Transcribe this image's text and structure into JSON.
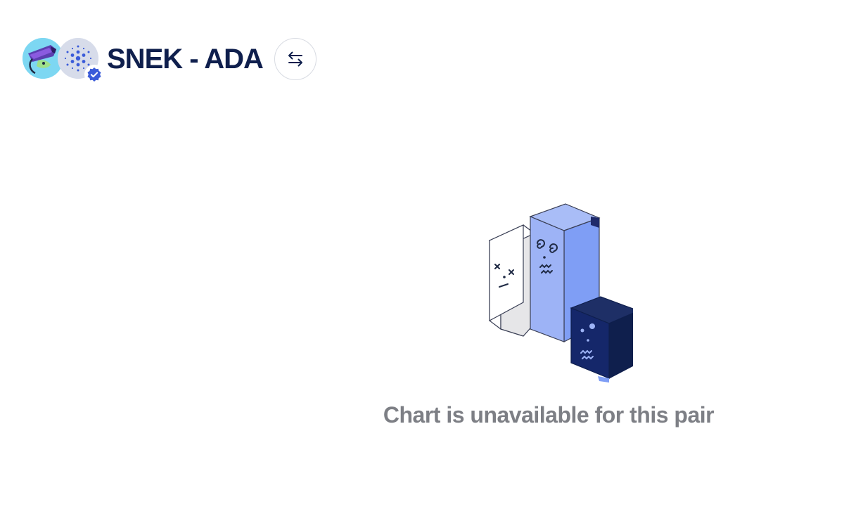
{
  "header": {
    "base_token": {
      "symbol": "SNEK",
      "icon": "snek-token-icon"
    },
    "quote_token": {
      "symbol": "ADA",
      "icon": "cardano-token-icon",
      "verified": true
    },
    "pair_title": "SNEK - ADA",
    "swap_icon": "swap-arrows-icon"
  },
  "chart_area": {
    "illustration": "sad-bar-blocks-illustration",
    "message": "Chart is unavailable for this pair"
  },
  "colors": {
    "title": "#0f1f4d",
    "message": "#7d7f85",
    "accent_blue": "#7f9ef5",
    "dark_navy": "#0f1f4d",
    "verified_badge": "#3a5bd9"
  }
}
